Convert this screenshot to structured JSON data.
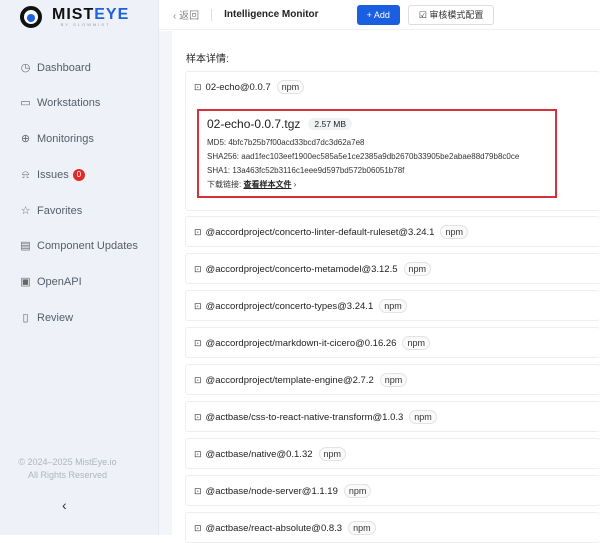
{
  "brand": {
    "name_dark": "MIST",
    "name_blue": "EYE",
    "sub": "BY SLOWMIST"
  },
  "sidebar": {
    "items": [
      {
        "label": "Dashboard",
        "icon": "dashboard-icon",
        "glyph": "◷"
      },
      {
        "label": "Workstations",
        "icon": "monitor-icon",
        "glyph": "▭"
      },
      {
        "label": "Monitorings",
        "icon": "crosshair-icon",
        "glyph": "⊕"
      },
      {
        "label": "Issues",
        "icon": "bell-icon",
        "glyph": "⍾",
        "badge": "0"
      },
      {
        "label": "Favorites",
        "icon": "star-icon",
        "glyph": "☆"
      },
      {
        "label": "Component Updates",
        "icon": "archive-icon",
        "glyph": "▤"
      },
      {
        "label": "OpenAPI",
        "icon": "api-icon",
        "glyph": "▣"
      },
      {
        "label": "Review",
        "icon": "file-check-icon",
        "glyph": "▯"
      }
    ],
    "copyright": "© 2024–2025 MistEye.io",
    "rights": "All Rights Reserved",
    "collapse": "‹"
  },
  "header": {
    "back": "‹  返回",
    "title": "Intelligence Monitor",
    "add": "+ Add",
    "config": "☑ 审核模式配置"
  },
  "section_title": "样本详情:",
  "first": {
    "name": "02-echo@0.0.7",
    "tag": "npm",
    "file": {
      "name": "02-echo-0.0.7.tgz",
      "size": "2.57 MB",
      "md5": "MD5: 4bfc7b25b7f00acd33bcd7dc3d62a7e8",
      "sha256": "SHA256: aad1fec103eef1900ec585a5e1ce2385a9db2670b33905be2abae88d79b8c0ce",
      "sha1": "SHA1: 13a463fc52b3116c1eee9d597bd572b06051b78f",
      "dl_label": "下载链接: ",
      "dl_link": "查看样本文件",
      "dl_arrow": " ›"
    }
  },
  "packages": [
    {
      "name": "@accordproject/concerto-linter-default-ruleset@3.24.1",
      "tag": "npm"
    },
    {
      "name": "@accordproject/concerto-metamodel@3.12.5",
      "tag": "npm"
    },
    {
      "name": "@accordproject/concerto-types@3.24.1",
      "tag": "npm"
    },
    {
      "name": "@accordproject/markdown-it-cicero@0.16.26",
      "tag": "npm"
    },
    {
      "name": "@accordproject/template-engine@2.7.2",
      "tag": "npm"
    },
    {
      "name": "@actbase/css-to-react-native-transform@1.0.3",
      "tag": "npm"
    },
    {
      "name": "@actbase/native@0.1.32",
      "tag": "npm"
    },
    {
      "name": "@actbase/node-server@1.1.19",
      "tag": "npm"
    },
    {
      "name": "@actbase/react-absolute@0.8.3",
      "tag": "npm"
    }
  ]
}
